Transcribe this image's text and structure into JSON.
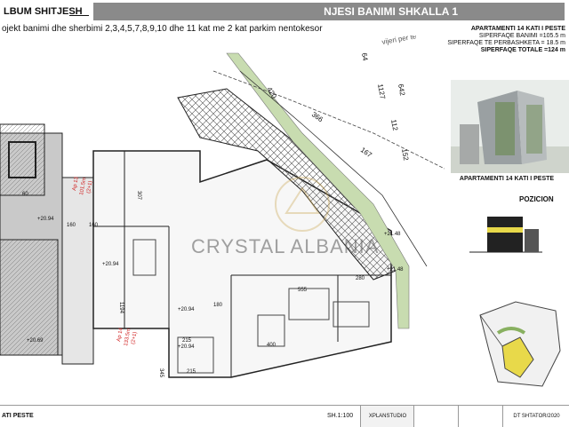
{
  "header": {
    "album_label": "LBUM SHITJESH",
    "title": "NJESI BANIMI  SHKALLA 1",
    "subtitle": "ojekt banimi dhe sherbimi 2,3,4,5,7,8,9,10 dhe 11 kat me 2 kat parkim nentokesor"
  },
  "info": {
    "apartment": "APARTAMENTI 14 KATI I PESTE",
    "area_living": "SIPERFAQE BANIMI =105.5 m",
    "area_common": "SIPERFAQE TE PERBASHKETA = 18.5 m",
    "area_total": "SIPERFAQE TOTALE =124 m"
  },
  "labels": {
    "pozicion": "POZICION",
    "watermark": "CRYSTAL ALBANIA",
    "apt_red_1": "Ap 13",
    "apt_red_1_area": "101.5m",
    "apt_red_1_type": "(2+1)",
    "apt_red_2": "Ap 14",
    "apt_red_2_area": "133.5m",
    "apt_red_2_type": "(2+1)",
    "level_1": "+20.94",
    "level_2": "+20.94",
    "level_3": "+20.94",
    "level_4": "+21.48",
    "level_5": "+21.48",
    "level_6": "+20.94",
    "level_7": "+20.69",
    "dims": [
      "420",
      "366",
      "167",
      "64",
      "642",
      "1127",
      "112",
      "152",
      "60",
      "160",
      "1194",
      "307",
      "215",
      "180",
      "280",
      "555",
      "345",
      "400",
      "215",
      "160"
    ],
    "vijer": "vijeri per te"
  },
  "footer": {
    "left": "ATI PESTE",
    "scale": "SH.1:100",
    "studio": "XPLANSTUDIO",
    "cell_3": "",
    "cell_4": "DT SHTATOR/2020"
  },
  "colors": {
    "title_bar": "#8a8a8a",
    "green_strip": "#c8dcb0",
    "hatch": "#555555",
    "red_text": "#d02020",
    "accent_yellow": "#e8d94a"
  }
}
